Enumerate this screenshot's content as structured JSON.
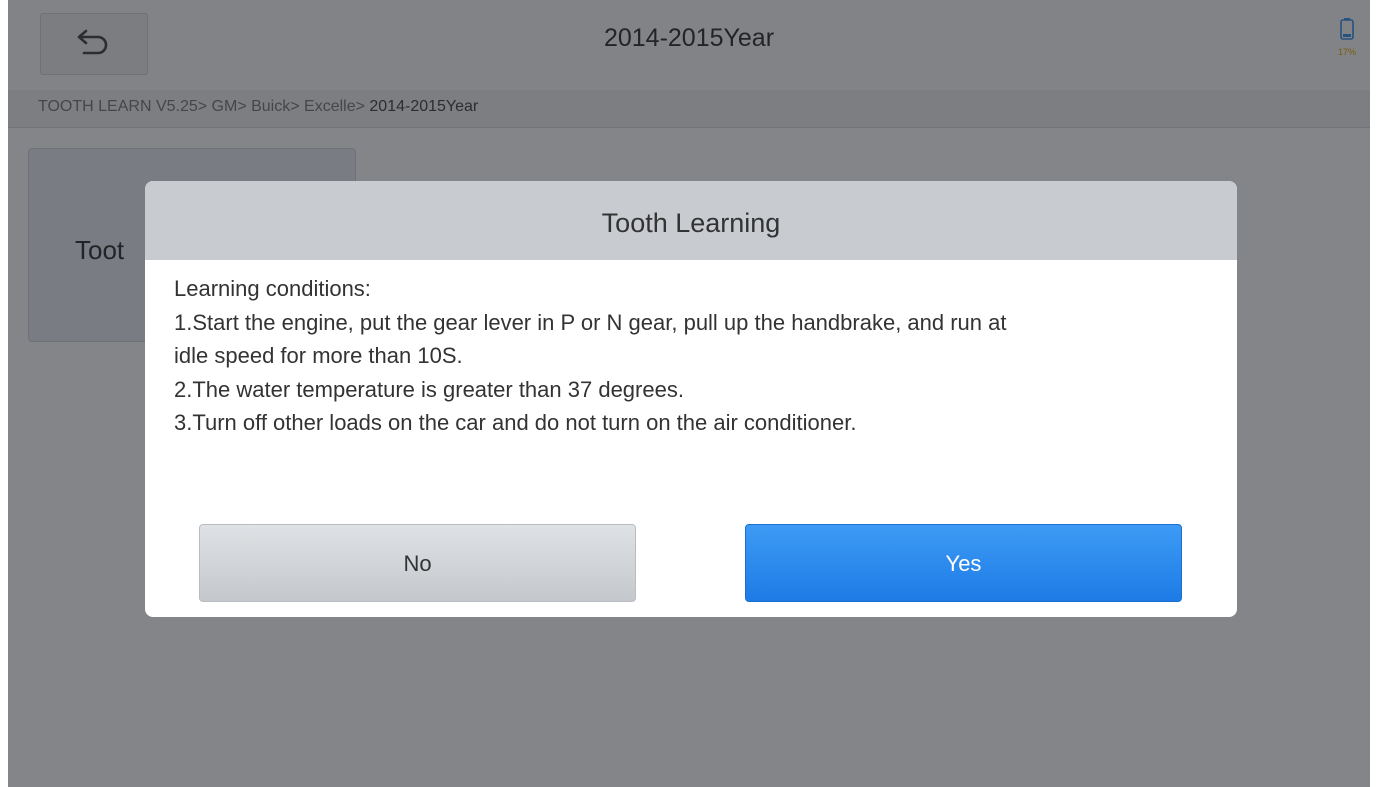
{
  "header": {
    "title": "2014-2015Year",
    "back_icon": "back-arrow-icon",
    "battery_icon": "battery-icon",
    "battery_level": "17%"
  },
  "breadcrumb": {
    "path": "TOOTH LEARN V5.25> GM> Buick> Excelle> ",
    "current": "2014-2015Year"
  },
  "content": {
    "tile_label": "Toot"
  },
  "dialog": {
    "title": "Tooth Learning",
    "lines": [
      "Learning conditions:",
      "1.Start the engine, put the gear lever in P or N gear, pull up the handbrake, and run at",
      "idle speed for more than 10S.",
      "2.The water temperature is greater than 37 degrees.",
      "3.Turn off other loads on the car and do not turn on the air conditioner."
    ],
    "no_label": "No",
    "yes_label": "Yes"
  },
  "colors": {
    "accent": "#1e7be6",
    "overlay": "#5e6065"
  }
}
